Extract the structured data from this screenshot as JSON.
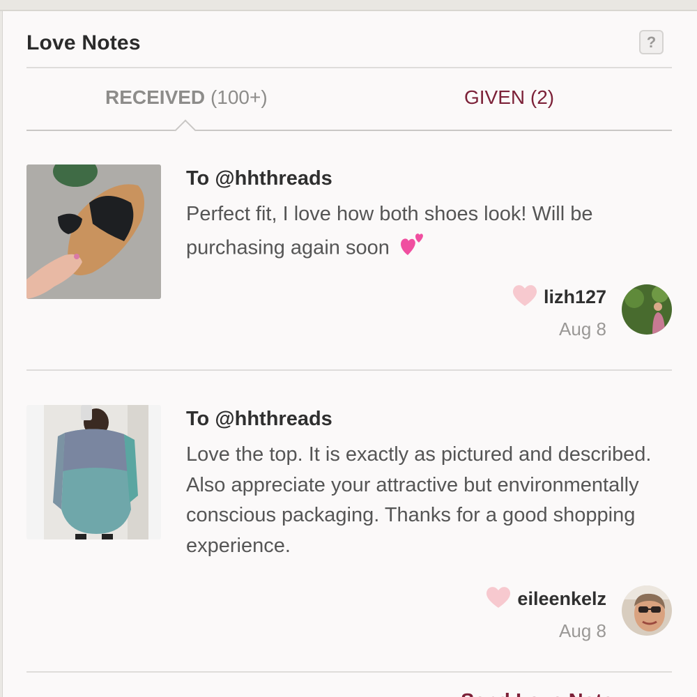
{
  "header": {
    "title": "Love Notes",
    "help_label": "?"
  },
  "tabs": {
    "received": {
      "label": "RECEIVED",
      "count": "(100+)"
    },
    "given": {
      "label": "GIVEN (2)"
    }
  },
  "notes": [
    {
      "recipient": "To @hhthreads",
      "message": "Perfect fit, I love how both shoes look! Will be purchasing again soon",
      "author": "lizh127",
      "date": "Aug 8"
    },
    {
      "recipient": "To @hhthreads",
      "message": "Love the top. It is exactly as pictured and described. Also appreciate your attractive but environmentally conscious packaging. Thanks for a good shopping experience.",
      "author": "eileenkelz",
      "date": "Aug 8"
    }
  ],
  "footer": {
    "link_label": "Send Love Note"
  },
  "colors": {
    "accent": "#7c2138",
    "like_heart": "#f7c9cf",
    "emoji_heart": "#f04fa0"
  }
}
